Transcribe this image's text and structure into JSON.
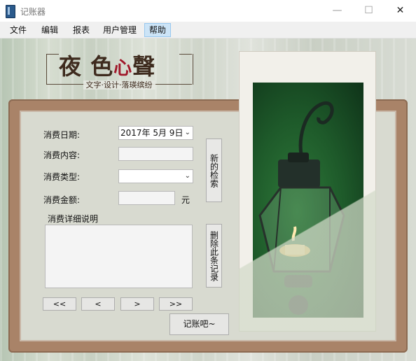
{
  "window": {
    "title": "记账器",
    "minimize_icon": "minimize-icon",
    "maximize_icon": "maximize-icon",
    "close_icon": "close-icon"
  },
  "menu": [
    "文件",
    "编辑",
    "报表",
    "用户管理",
    "帮助"
  ],
  "logo": {
    "char1": "夜",
    "char2": "色",
    "char3": "心",
    "char4": "聲",
    "subtitle": "文字·设计·落瑛缤纷"
  },
  "form": {
    "date_label": "消费日期:",
    "date_value": "2017年 5月 9日",
    "content_label": "消费内容:",
    "content_value": "",
    "type_label": "消费类型:",
    "type_value": "",
    "amount_label": "消费金额:",
    "amount_value": "",
    "amount_unit": "元",
    "detail_label": "消费详细说明",
    "detail_value": ""
  },
  "buttons": {
    "new_record": "新的检索",
    "delete_record": "删除此条记录",
    "first": "<<",
    "prev": "<",
    "next": ">",
    "last": ">>",
    "submit": "记账吧~"
  },
  "colors": {
    "frame": "#a98368",
    "menu_active": "#cce4f7",
    "logo_red": "#a0182a"
  }
}
